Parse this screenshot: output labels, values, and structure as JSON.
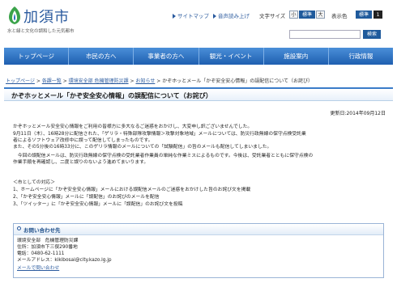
{
  "header": {
    "site_name": "加須市",
    "tagline": "水と緑と文化の調和した元気都市",
    "sitemap": "サイトマップ",
    "voice": "音声読み上げ",
    "font_size_label": "文字サイズ",
    "font_small": "小",
    "font_standard": "標準",
    "font_large": "大",
    "display_label": "表示色",
    "color_standard": "標準",
    "color_1": "1",
    "search_placeholder": "",
    "search_button": "検索"
  },
  "nav": {
    "items": [
      "トップページ",
      "市民の方へ",
      "事業者の方へ",
      "観光・イベント",
      "施設案内",
      "行政情報"
    ]
  },
  "breadcrumb": {
    "items": [
      "トップページ",
      "各課一覧",
      "環境安全部 危機管理防災課",
      "お知らせ"
    ],
    "current": "かぞホッとメール「かぞ安全安心情報」の誤配信について（お詫び）",
    "sep": ">"
  },
  "article": {
    "title": "かぞホッとメール「かぞ安全安心情報」の誤配信について（お詫び）",
    "updated": "更新日:2014年09月12日",
    "lines": [
      "かぞホッとメール安全安心情報をご利用の皆様方に多大なるご迷惑をおかけし、大変申し訳ございませんでした。",
      "9月11日（木）、16時28分に配信された、「ゲリラ・特殊部隊攻撃情報＞攻撃対象地域」メールについては、防災行政無線の保守点検受託業",
      "者によるソフトウェア改修中に誤って配信してしまったものです。",
      "また、その5分後の16時33分に、このゲリラ情報のメールについての「試験配信」の旨のメールも配信してしまいました。",
      "　今回の誤配信メールは、防災行政無線の保守点検の受託業者作業員の単純な作業ミスによるものです。今後は、受託業者とともに保守点検の",
      "作業手順を再確認し、二度と誤りのないよう進めてまいります。"
    ],
    "response_heading": "＜市としての対応＞",
    "responses": [
      "1、ホームページに「かぞ安全安心情報」メールにおける誤配信メールのご迷惑をおかけした旨のお詫び文を掲載",
      "2、「かぞ安全安心情報」メールに「誤配信」のお詫びのメールを配信",
      "3、「ツイッター」に「かぞ安全安心情報」メールに「誤配信」のお詫び文を投稿"
    ]
  },
  "contact": {
    "heading": "お問い合わせ先",
    "dept": "環境安全部　危機管理防災課",
    "address": "住所：加須市下三俣290番地",
    "phone": "電話：0480-62-1111",
    "email": "メールアドレス：kikibosai@city.kazo.lg.jp",
    "link": "メールで問い合わせ"
  },
  "colors": {
    "nav_top": "#4a8fd8",
    "nav_bottom": "#1f5fb0",
    "link": "#2a5a9e",
    "accent": "#3a7cc8"
  }
}
